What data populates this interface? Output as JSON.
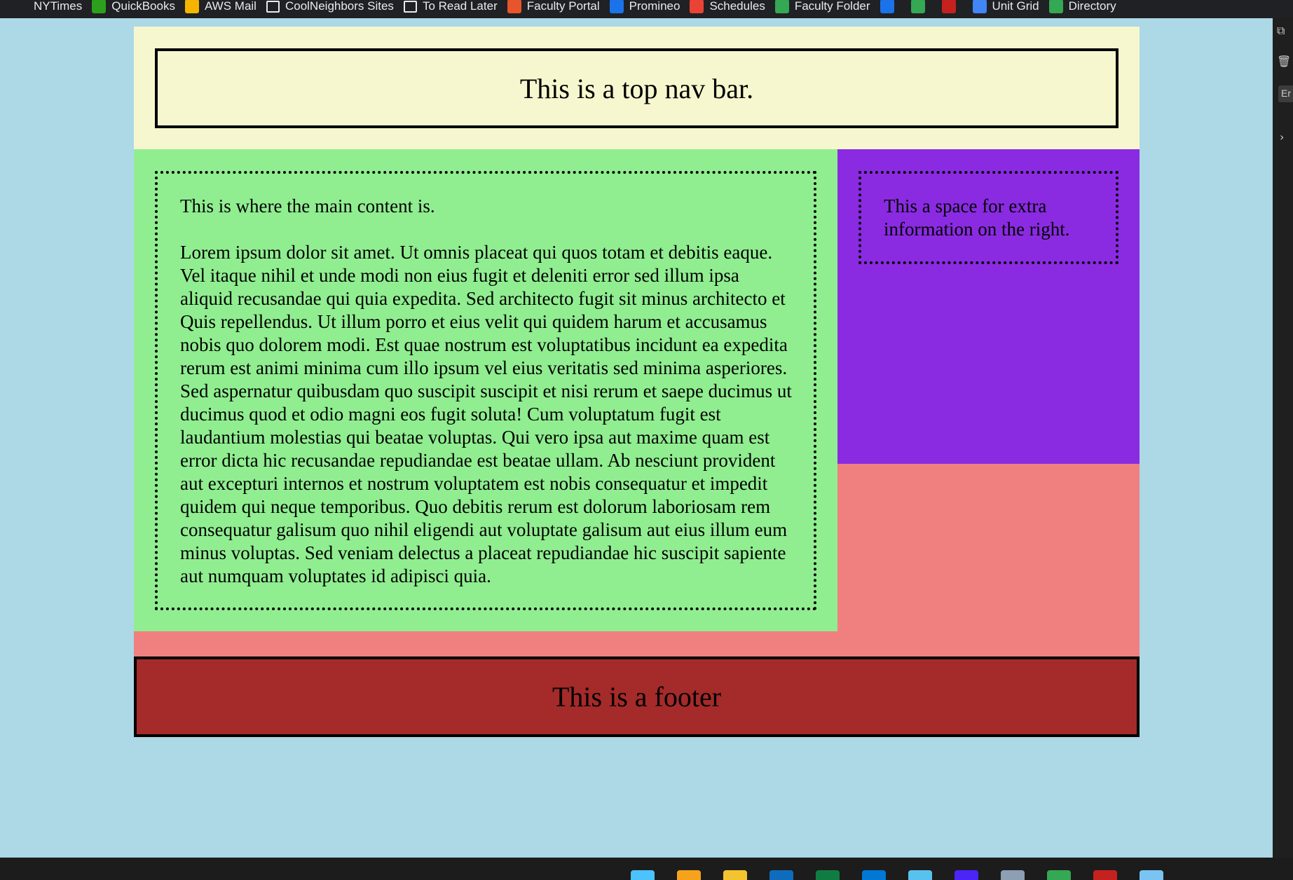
{
  "browser": {
    "bookmarks": [
      {
        "label": "NYTimes",
        "icon": "nytimes-icon",
        "color": "#202124"
      },
      {
        "label": "QuickBooks",
        "icon": "quickbooks-icon",
        "color": "#2ca01c"
      },
      {
        "label": "AWS Mail",
        "icon": "folder-icon",
        "color": "#f4b400"
      },
      {
        "label": "CoolNeighbors Sites",
        "icon": "folder-outline-icon",
        "color": "outline"
      },
      {
        "label": "To Read Later",
        "icon": "folder-outline-icon",
        "color": "outline"
      },
      {
        "label": "Faculty Portal",
        "icon": "faculty-portal-icon",
        "color": "#e8542b"
      },
      {
        "label": "Promineo",
        "icon": "promineo-icon",
        "color": "#1a73e8"
      },
      {
        "label": "Schedules",
        "icon": "calendar-icon",
        "color": "#ea4335"
      },
      {
        "label": "Faculty Folder",
        "icon": "google-drive-icon",
        "color": "#34a853"
      }
    ],
    "icon_bookmarks": [
      {
        "icon": "bookmark-blue-icon",
        "color": "#1a73e8"
      },
      {
        "icon": "leaf-icon",
        "color": "#34a853"
      },
      {
        "icon": "bookmark-red-icon",
        "color": "#c5221f"
      }
    ],
    "bookmarks_right": [
      {
        "label": "Unit Grid",
        "icon": "google-docs-icon",
        "color": "#4285f4"
      },
      {
        "label": "Directory",
        "icon": "plus-icon",
        "color": "#34a853"
      }
    ]
  },
  "page": {
    "nav_text": "This is a top nav bar.",
    "main_intro": "This is where the main content is.",
    "main_body": "Lorem ipsum dolor sit amet. Ut omnis placeat qui quos totam et debitis eaque. Vel itaque nihil et unde modi non eius fugit et deleniti error sed illum ipsa aliquid recusandae qui quia expedita. Sed architecto fugit sit minus architecto et Quis repellendus. Ut illum porro et eius velit qui quidem harum et accusamus nobis quo dolorem modi. Est quae nostrum est voluptatibus incidunt ea expedita rerum est animi minima cum illo ipsum vel eius veritatis sed minima asperiores. Sed aspernatur quibusdam quo suscipit suscipit et nisi rerum et saepe ducimus ut ducimus quod et odio magni eos fugit soluta! Cum voluptatum fugit est laudantium molestias qui beatae voluptas. Qui vero ipsa aut maxime quam est error dicta hic recusandae repudiandae est beatae ullam. Ab nesciunt provident aut excepturi internos et nostrum voluptatem est nobis consequatur et impedit quidem qui neque temporibus. Quo debitis rerum est dolorum laboriosam rem consequatur galisum quo nihil eligendi aut voluptate galisum aut eius illum eum minus voluptas. Sed veniam delectus a placeat repudiandae hic suscipit sapiente aut numquam voluptates id adipisci quia.",
    "aside_text": "This a space for extra information on the right.",
    "footer_text": "This is a footer"
  },
  "devtools": {
    "en_label": "Er"
  },
  "taskbar": {
    "apps": [
      {
        "icon": "windows-start-icon",
        "color": "#4cc2ff"
      },
      {
        "icon": "widgets-icon",
        "color": "#f7a21b"
      },
      {
        "icon": "file-explorer-icon",
        "color": "#f4c430"
      },
      {
        "icon": "outlook-icon",
        "color": "#0f6cbd"
      },
      {
        "icon": "excel-icon",
        "color": "#107c41"
      },
      {
        "icon": "vscode-icon",
        "color": "#0078d4"
      },
      {
        "icon": "notepad-icon",
        "color": "#59c1f0"
      },
      {
        "icon": "amazon-icon",
        "color": "#4b24f7"
      },
      {
        "icon": "calculator-icon",
        "color": "#8c9fb3"
      },
      {
        "icon": "chrome-icon",
        "color": "#34a853"
      },
      {
        "icon": "app-red-icon",
        "color": "#c5221f"
      },
      {
        "icon": "photos-icon",
        "color": "#79c4f2"
      }
    ]
  }
}
